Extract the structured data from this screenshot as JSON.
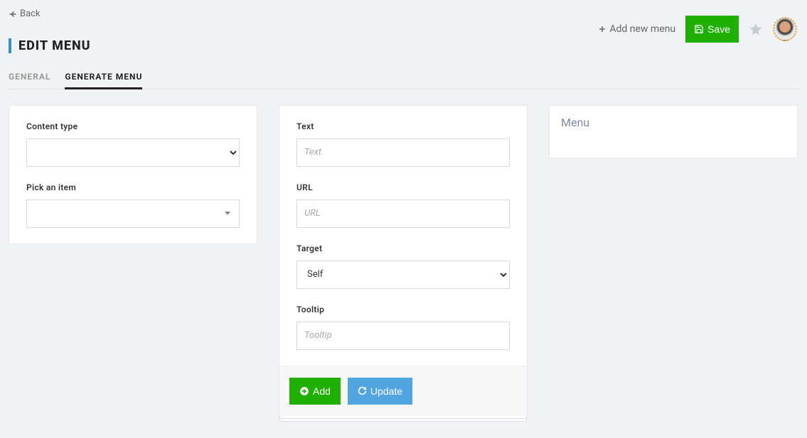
{
  "back": {
    "label": "Back"
  },
  "header": {
    "title": "EDIT MENU",
    "add_new": "Add new menu",
    "save": "Save"
  },
  "tabs": {
    "general": "GENERAL",
    "generate": "GENERATE MENU"
  },
  "left_panel": {
    "content_type_label": "Content type",
    "pick_item_label": "Pick an item"
  },
  "center_panel": {
    "text_label": "Text",
    "text_placeholder": "Text",
    "url_label": "URL",
    "url_placeholder": "URL",
    "target_label": "Target",
    "target_value": "Self",
    "tooltip_label": "Tooltip",
    "tooltip_placeholder": "Tooltip",
    "add_btn": "Add",
    "update_btn": "Update"
  },
  "right_panel": {
    "title": "Menu"
  }
}
